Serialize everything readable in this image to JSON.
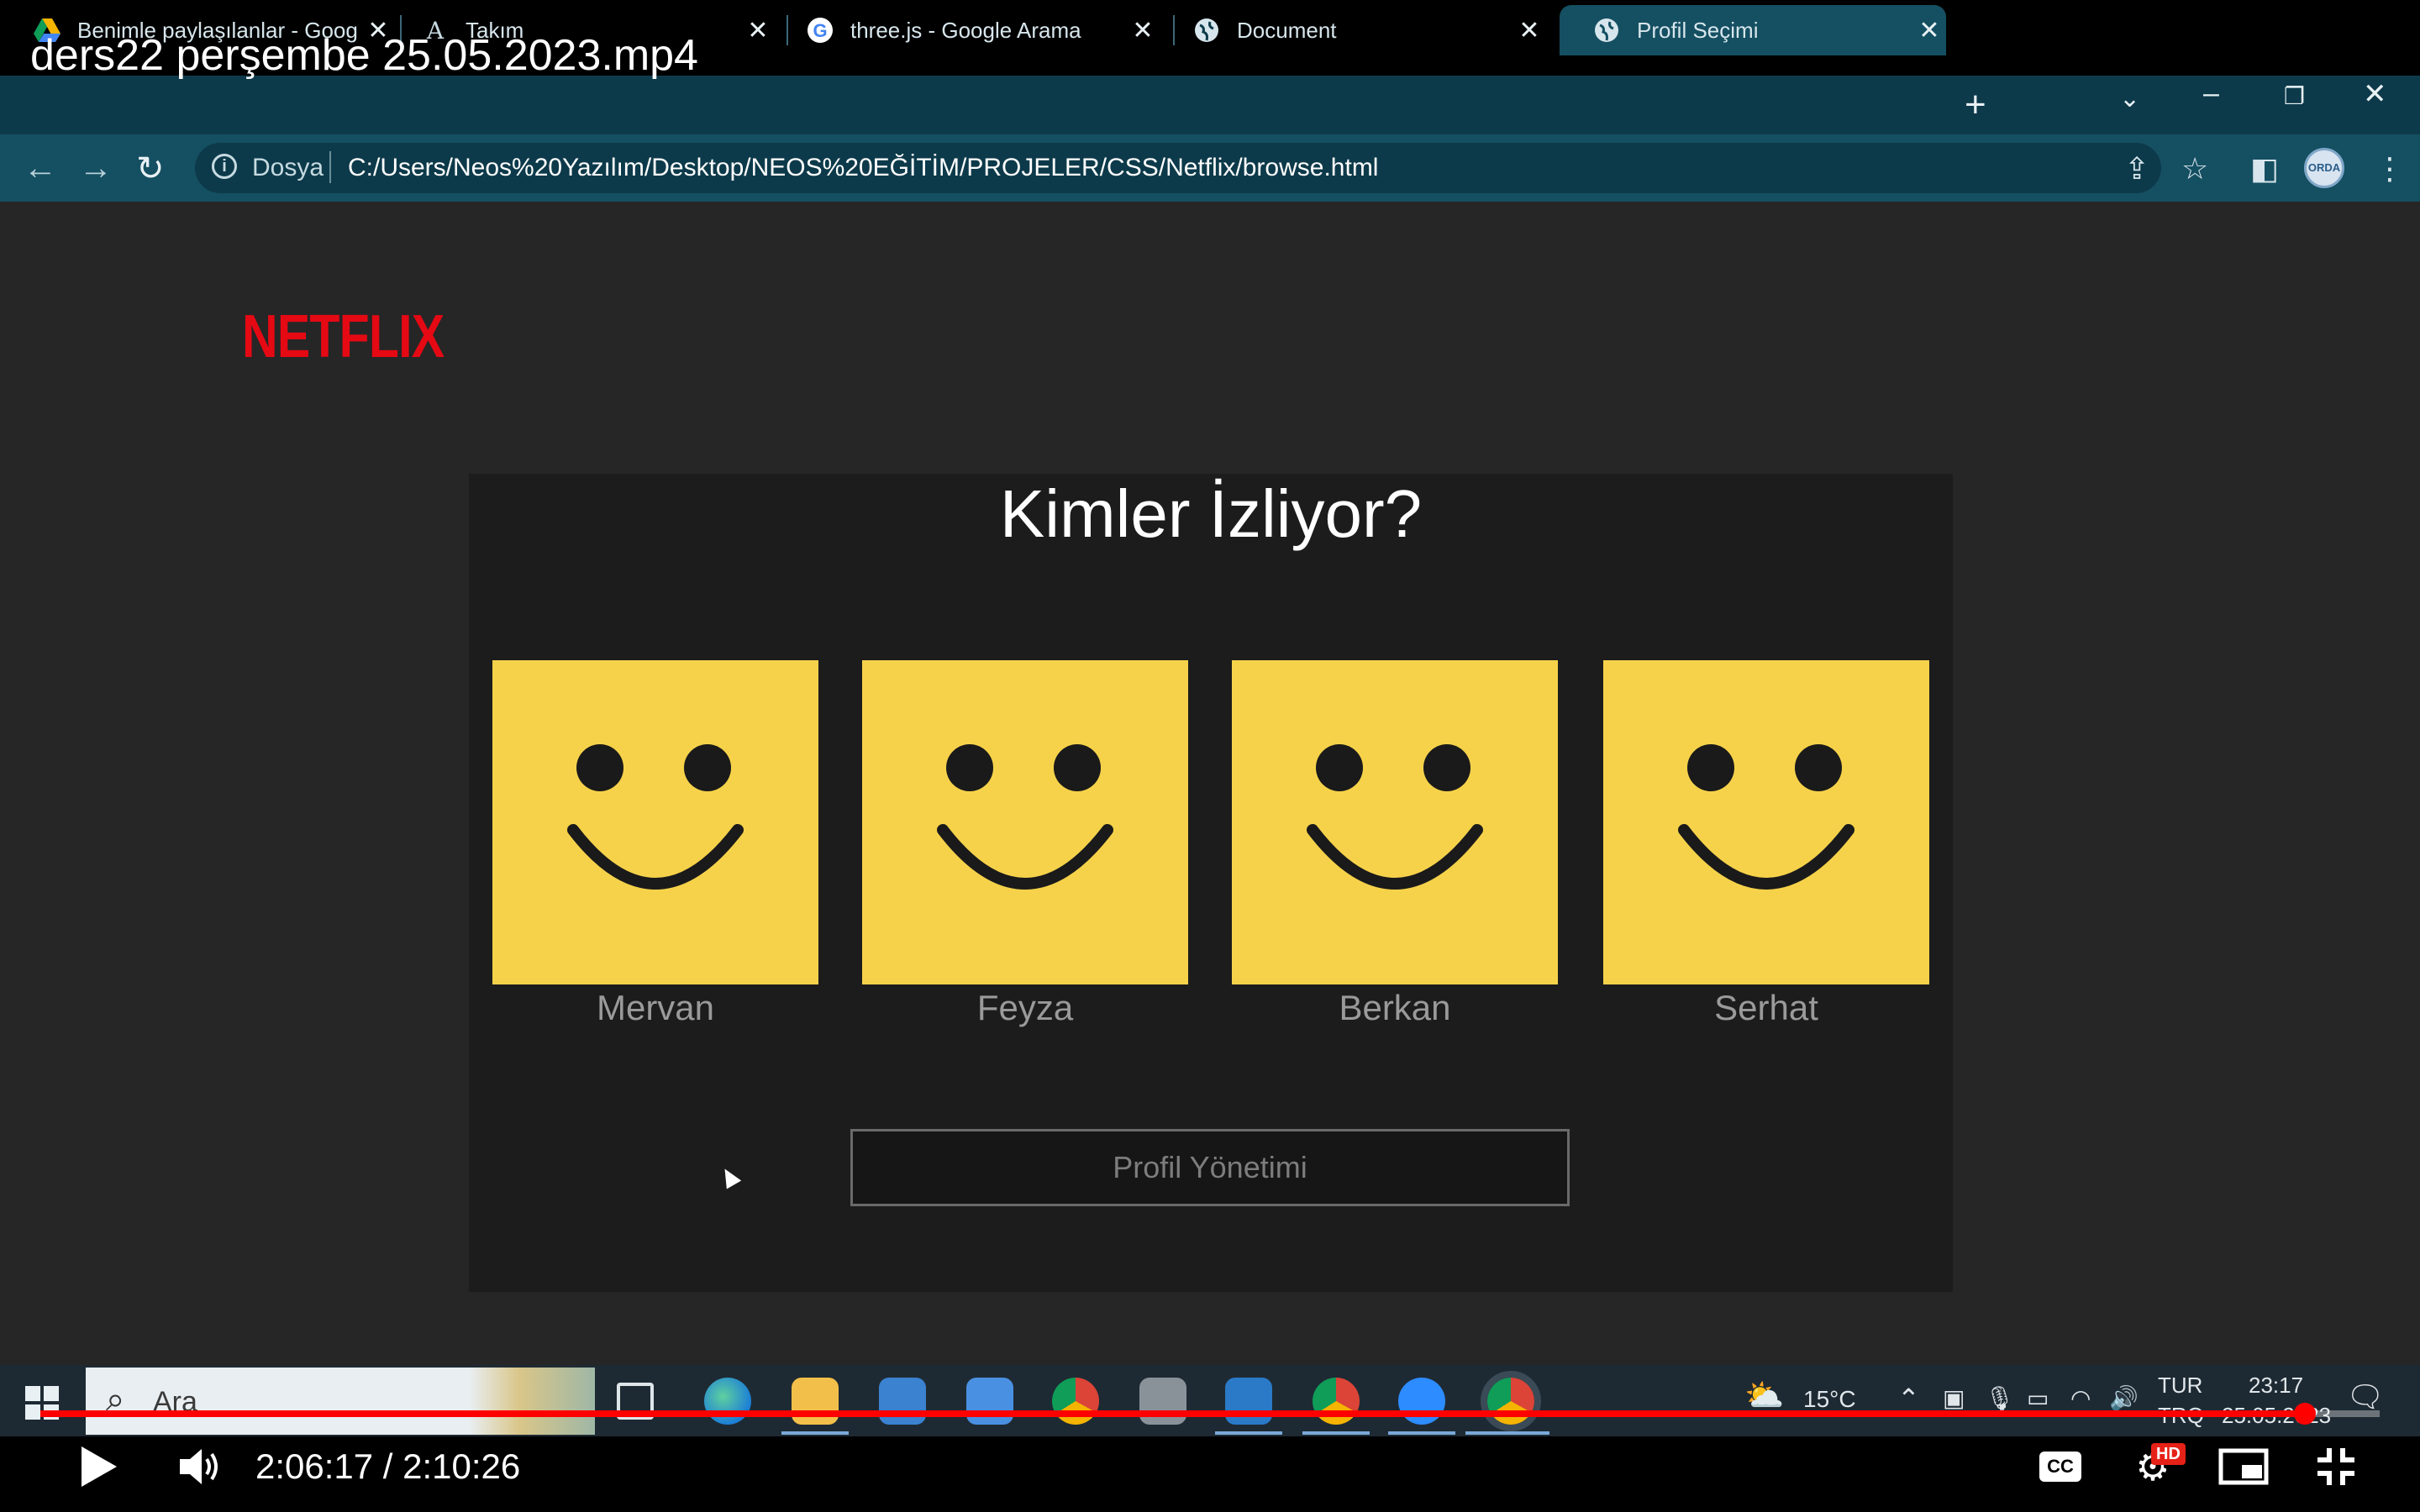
{
  "video": {
    "title": "ders22 perşembe 25.05.2023.mp4",
    "current_time": "2:06:17",
    "duration": "2:10:26",
    "time_display": "2:06:17 / 2:10:26",
    "progress": 0.968,
    "cc_label": "CC",
    "hd_label": "HD"
  },
  "browser": {
    "tabs": [
      {
        "label": "Benimle paylaşılanlar - Goog",
        "icon": "google-drive-icon",
        "active": false
      },
      {
        "label": "Takım",
        "icon": "font-a-icon",
        "active": false
      },
      {
        "label": "three.js - Google Arama",
        "icon": "google-icon",
        "active": false
      },
      {
        "label": "Document",
        "icon": "globe-icon",
        "active": false
      },
      {
        "label": "Profil Seçimi",
        "icon": "globe-icon",
        "active": true
      }
    ],
    "address": {
      "scheme_label": "Dosya",
      "url": "C:/Users/Neos%20Yazılım/Desktop/NEOS%20EĞİTİM/PROJELER/CSS/Netflix/browse.html"
    },
    "avatar_label": "ORDA"
  },
  "page": {
    "logo": "NETFLIX",
    "heading": "Kimler İzliyor?",
    "profiles": [
      {
        "name": "Mervan"
      },
      {
        "name": "Feyza"
      },
      {
        "name": "Berkan"
      },
      {
        "name": "Serhat"
      }
    ],
    "manage_button": "Profil Yönetimi",
    "colors": {
      "background": "#262626",
      "panel": "#1c1c1c",
      "avatar": "#f6d24a",
      "logo": "#e50914"
    }
  },
  "taskbar": {
    "search_placeholder": "Ara",
    "weather": "15°C",
    "language_top": "TUR",
    "language_bottom": "TRQ",
    "time": "23:17",
    "date": "25.05.2023"
  }
}
